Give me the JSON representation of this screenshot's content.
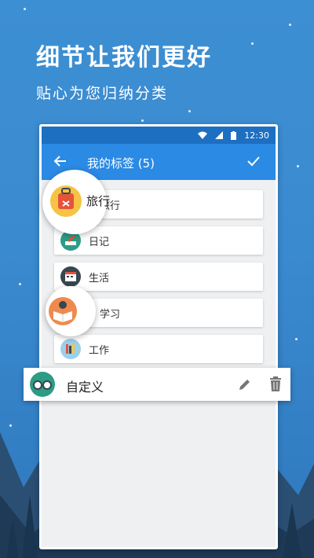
{
  "promo": {
    "headline": "细节让我们更好",
    "subline": "贴心为您归纳分类"
  },
  "status_bar": {
    "time": "12:30"
  },
  "app_bar": {
    "title": "我的标签 (5)"
  },
  "tags": [
    {
      "label": "旅行",
      "icon": "luggage-icon",
      "color": "#f6c344"
    },
    {
      "label": "日记",
      "icon": "diary-pen-icon",
      "color": "#2d9c86"
    },
    {
      "label": "生活",
      "icon": "calendar-icon",
      "color": "#37474f"
    },
    {
      "label": "学习",
      "icon": "reading-book-icon",
      "color": "#ef8a4e"
    },
    {
      "label": "工作",
      "icon": "books-icon",
      "color": "#9ad0ec"
    }
  ],
  "custom_tag": {
    "label": "自定义",
    "icon": "glasses-icon",
    "actions": [
      "edit-icon",
      "delete-icon"
    ]
  },
  "colors": {
    "accent": "#2b8ae4",
    "status_bar": "#1d6fc1",
    "background": "#3a8ad0"
  }
}
